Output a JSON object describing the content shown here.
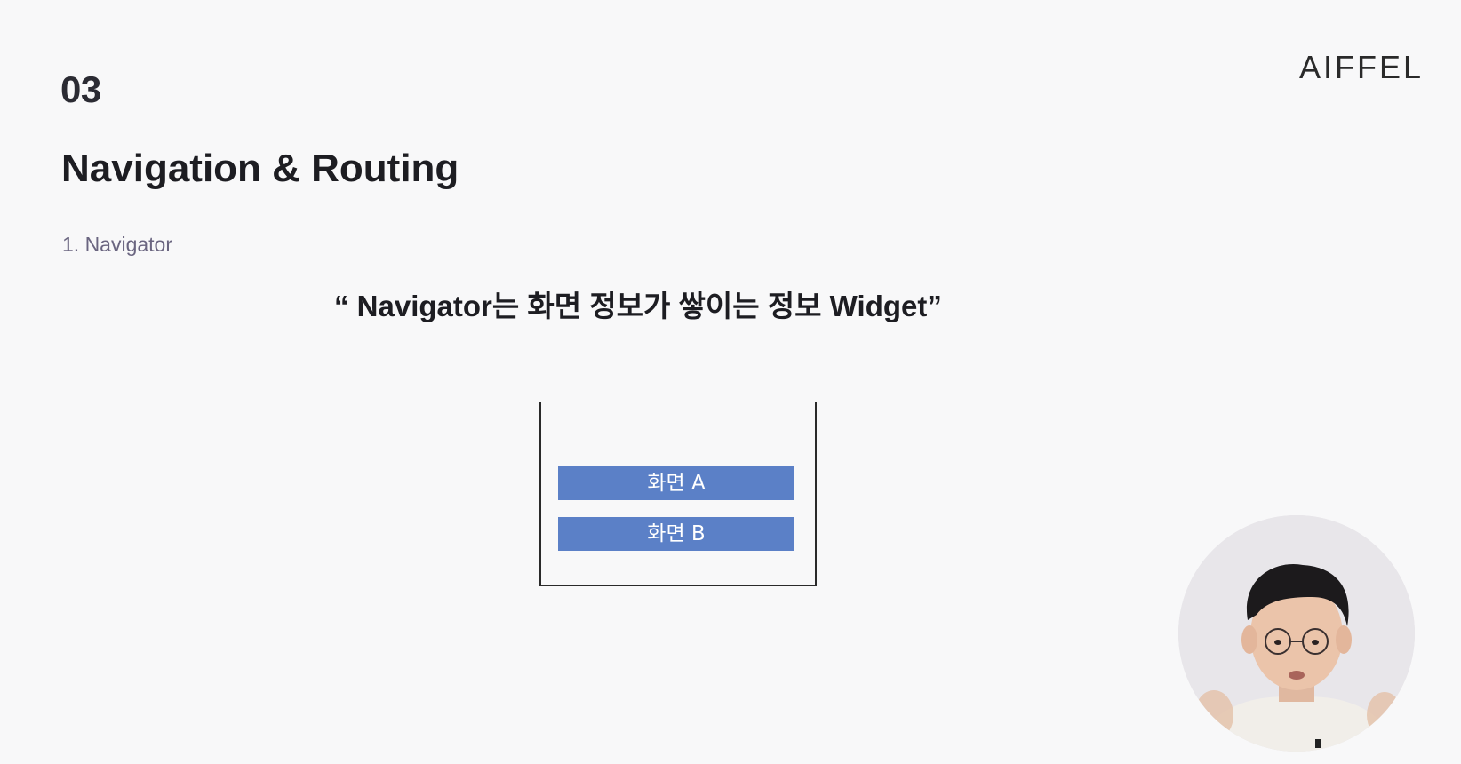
{
  "slide": {
    "section_number": "03",
    "title": "Navigation & Routing",
    "subheading": "1. Navigator",
    "quote": "“ Navigator는 화면 정보가 쌓이는 정보 Widget”",
    "logo": "AIFFEL"
  },
  "stack": {
    "items": [
      {
        "label": "화면 A"
      },
      {
        "label": "화면 B"
      }
    ],
    "item_color": "#5b80c7"
  },
  "presenter": {
    "icon": "presenter-webcam"
  }
}
